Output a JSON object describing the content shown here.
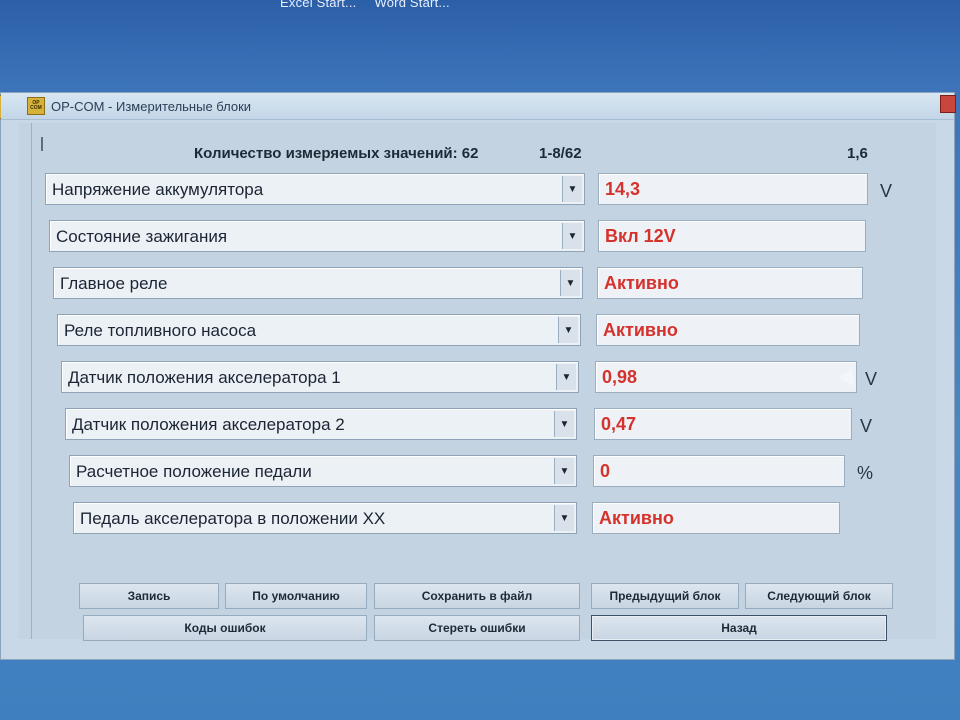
{
  "taskbar": {
    "items": [
      "Excel Start...",
      "Word Start..."
    ]
  },
  "window": {
    "title": "OP-COM - Измерительные блоки",
    "app_icon_text": "OP COM"
  },
  "header": {
    "count_label": "Количество измеряемых значений: 62",
    "range": "1-8/62",
    "version": "1,6"
  },
  "rows": [
    {
      "label": "Напряжение аккумулятора",
      "value": "14,3",
      "unit": "V"
    },
    {
      "label": "Состояние зажигания",
      "value": "Вкл  12V",
      "unit": ""
    },
    {
      "label": "Главное реле",
      "value": "Активно",
      "unit": ""
    },
    {
      "label": "Реле топливного насоса",
      "value": "Активно",
      "unit": ""
    },
    {
      "label": "Датчик положения акселератора 1",
      "value": "0,98",
      "unit": "V"
    },
    {
      "label": "Датчик положения акселератора 2",
      "value": "0,47",
      "unit": "V"
    },
    {
      "label": "Расчетное положение педали",
      "value": "0",
      "unit": "%"
    },
    {
      "label": "Педаль акселератора в положении XX",
      "value": "Активно",
      "unit": ""
    }
  ],
  "buttons": {
    "record": "Запись",
    "defaults": "По умолчанию",
    "save_file": "Сохранить в файл",
    "prev_block": "Предыдущий блок",
    "next_block": "Следующий блок",
    "error_codes": "Коды ошибок",
    "clear_errors": "Стереть ошибки",
    "back": "Назад"
  },
  "colors": {
    "value_text": "#d4322c",
    "window_bg": "#c9d8e6",
    "desktop": "#3d74b9"
  }
}
